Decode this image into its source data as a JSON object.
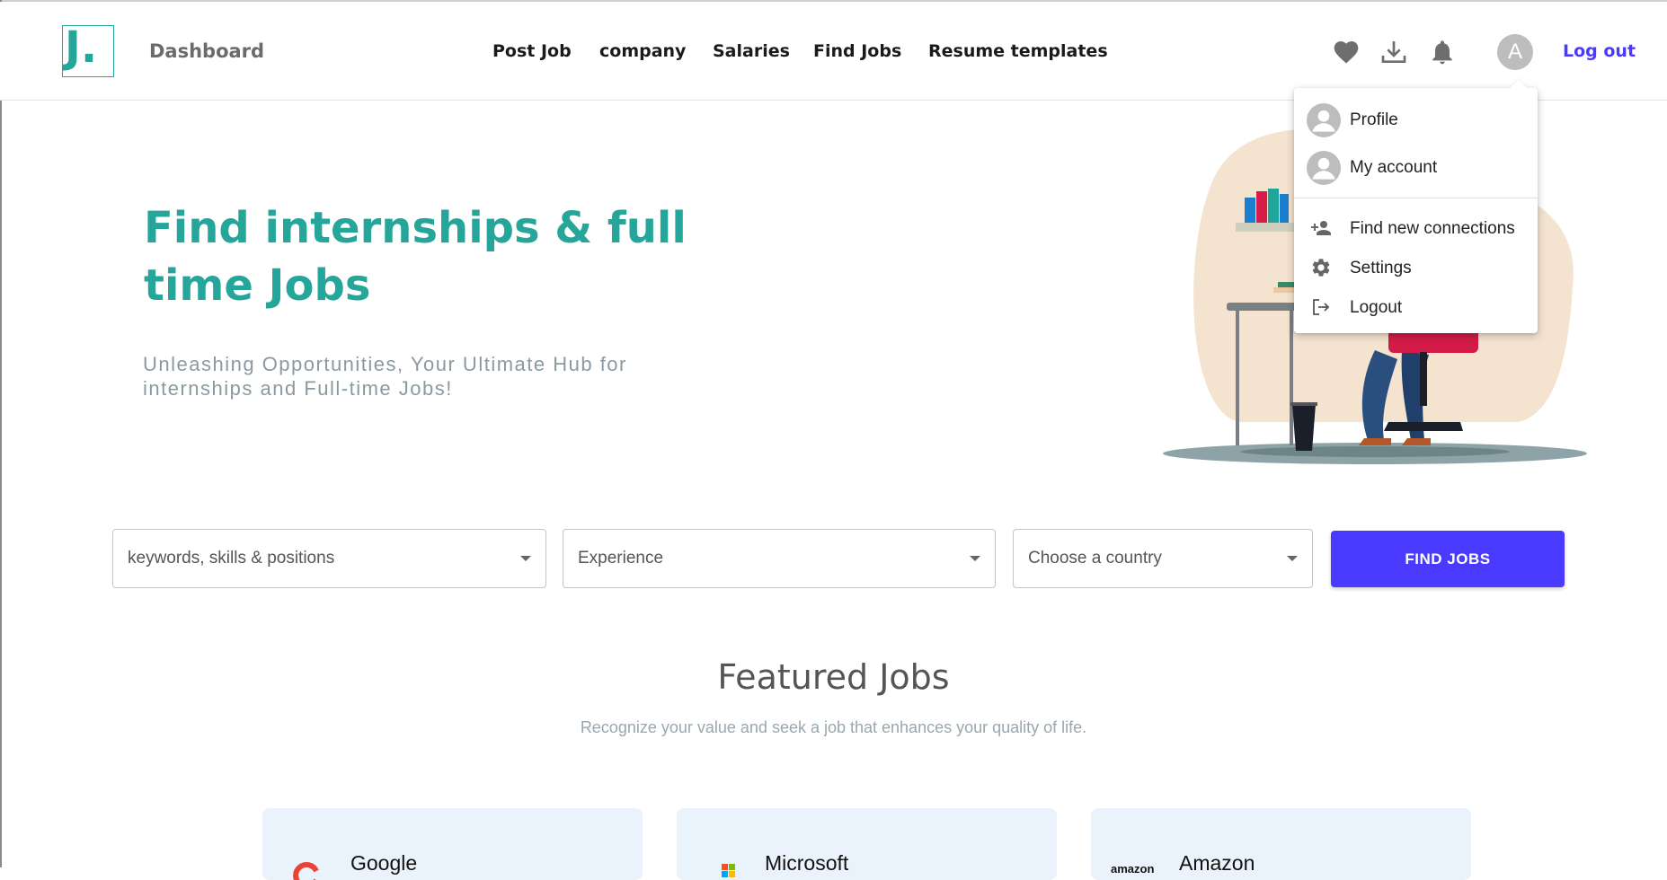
{
  "header": {
    "logo_text": "J.",
    "dashboard_label": "Dashboard",
    "nav": [
      "Post Job",
      "company",
      "Salaries",
      "Find Jobs",
      "Resume templates"
    ],
    "avatar_letter": "A",
    "logout_label": "Log out",
    "icons": [
      "heart-icon",
      "download-icon",
      "bell-icon"
    ]
  },
  "hero": {
    "title": "Find internships & full time Jobs",
    "subtitle": "Unleashing Opportunities, Your Ultimate Hub for internships and Full-time Jobs!"
  },
  "account_menu": {
    "items": [
      {
        "label": "Profile",
        "icon": "avatar-icon"
      },
      {
        "label": "My account",
        "icon": "avatar-icon"
      },
      {
        "label": "Find new connections",
        "icon": "person-add-icon"
      },
      {
        "label": "Settings",
        "icon": "gear-icon"
      },
      {
        "label": "Logout",
        "icon": "logout-icon"
      }
    ]
  },
  "search": {
    "keywords_placeholder": "keywords, skills & positions",
    "experience_placeholder": "Experience",
    "country_placeholder": "Choose a country",
    "find_button": "FIND JOBS"
  },
  "featured": {
    "title": "Featured Jobs",
    "subtitle": "Recognize your value and seek a job that enhances your quality of life.",
    "companies": [
      "Google",
      "Microsoft",
      "Amazon"
    ],
    "logo_text_amazon": "amazon"
  },
  "colors": {
    "brand": "#26a69a",
    "accent": "#4a3aff"
  }
}
